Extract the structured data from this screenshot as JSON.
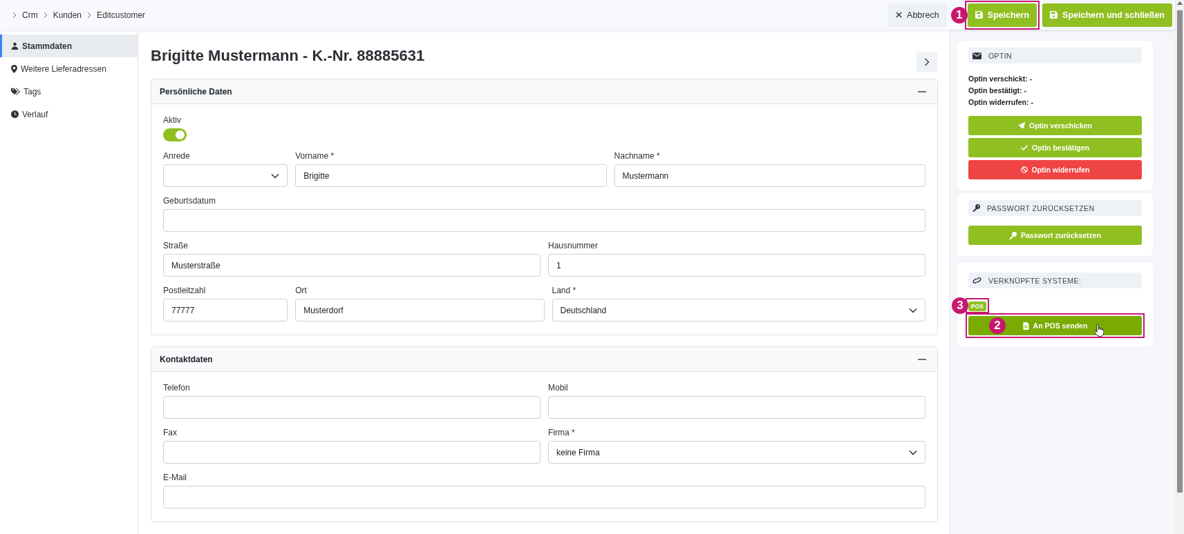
{
  "breadcrumb": [
    "Crm",
    "Kunden",
    "Editcustomer"
  ],
  "toolbar": [
    {
      "label": "Abbrech",
      "kind": "secondary"
    },
    {
      "label": "Speichern",
      "kind": "primary",
      "callout": "1"
    },
    {
      "label": "Speichern und schließen",
      "kind": "primary"
    }
  ],
  "sidebar": {
    "items": [
      {
        "label": "Stammdaten",
        "selected": true
      },
      {
        "label": "Weitere Lieferadressen",
        "selected": false
      },
      {
        "label": "Tags",
        "selected": false
      },
      {
        "label": "Verlauf",
        "selected": false
      }
    ]
  },
  "title": "Brigitte Mustermann - K.-Nr. 88885631",
  "sections": [
    {
      "title": "Persönliche Daten",
      "expanded": true,
      "toggle": {
        "label": "Aktiv",
        "on": true
      },
      "rows": [
        [
          {
            "label": "Anrede",
            "kind": "select"
          },
          {
            "label": "Vorname *",
            "kind": "text",
            "value": "Brigitte"
          },
          {
            "label": "Nachname *",
            "kind": "text",
            "value": "Mustermann"
          }
        ],
        [
          {
            "label": "Geburtsdatum",
            "kind": "text"
          }
        ],
        [
          {
            "label": "Straße",
            "kind": "text",
            "value": "Musterstraße"
          },
          {
            "label": "Hausnummer",
            "kind": "text",
            "value": "1"
          }
        ],
        [
          {
            "label": "Postleitzahl",
            "kind": "text",
            "value": "77777"
          },
          {
            "label": "Ort",
            "kind": "text",
            "value": "Musterdorf"
          },
          {
            "label": "Land *",
            "kind": "select",
            "value": "Deutschland"
          }
        ]
      ]
    },
    {
      "title": "Kontaktdaten",
      "expanded": true,
      "rows": [
        [
          {
            "label": "Telefon",
            "kind": "text"
          },
          {
            "label": "Mobil",
            "kind": "text"
          }
        ],
        [
          {
            "label": "Fax",
            "kind": "text"
          },
          {
            "label": "Firma *",
            "kind": "select",
            "value": "keine Firma"
          }
        ],
        [
          {
            "label": "E-Mail",
            "kind": "text"
          }
        ]
      ]
    }
  ],
  "panels": [
    {
      "title": "OPTIN",
      "lines": [
        "Optin verschickt: -",
        "Optin bestätigt: -",
        "Optin widerrufen: -"
      ],
      "buttons": [
        {
          "label": "Optin verschicken",
          "kind": "primary",
          "hovered": false
        },
        {
          "label": "Optin bestätigen",
          "kind": "primary",
          "hovered": false
        },
        {
          "label": "Optin widerrufen",
          "kind": "danger",
          "hovered": false
        }
      ]
    },
    {
      "title": "PASSWORT ZURÜCKSETZEN",
      "buttons": [
        {
          "label": "Passwort zurücksetzen",
          "kind": "primary",
          "hovered": false
        }
      ]
    },
    {
      "title": "VERKNÜPFTE SYSTEME:",
      "tags": [
        {
          "label": "POS",
          "callout": "3"
        }
      ],
      "buttons": [
        {
          "label": "An POS senden",
          "kind": "primary",
          "hovered": true,
          "callout": "2"
        }
      ]
    }
  ]
}
